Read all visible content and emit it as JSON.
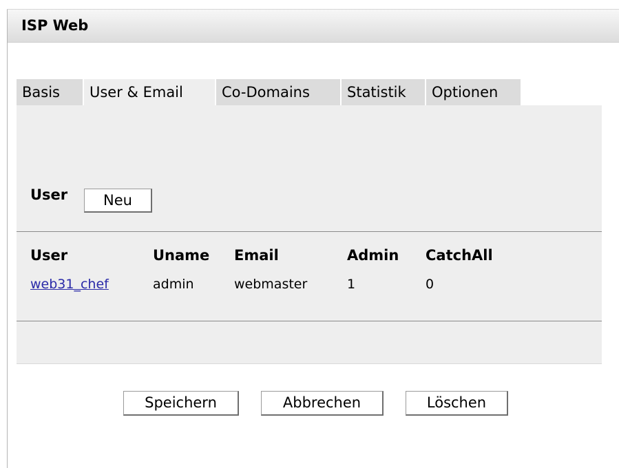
{
  "window": {
    "title": "ISP Web"
  },
  "tabs": [
    {
      "label": "Basis",
      "active": false
    },
    {
      "label": "User & Email",
      "active": true
    },
    {
      "label": "Co-Domains",
      "active": false
    },
    {
      "label": "Statistik",
      "active": false
    },
    {
      "label": "Optionen",
      "active": false
    }
  ],
  "user_section": {
    "label": "User",
    "new_button": "Neu"
  },
  "table": {
    "headers": [
      "User",
      "Uname",
      "Email",
      "Admin",
      "CatchAll"
    ],
    "rows": [
      {
        "user": "web31_chef",
        "uname": "admin",
        "email": "webmaster",
        "admin": "1",
        "catchall": "0"
      }
    ]
  },
  "actions": {
    "save": "Speichern",
    "cancel": "Abbrechen",
    "delete": "Löschen"
  }
}
